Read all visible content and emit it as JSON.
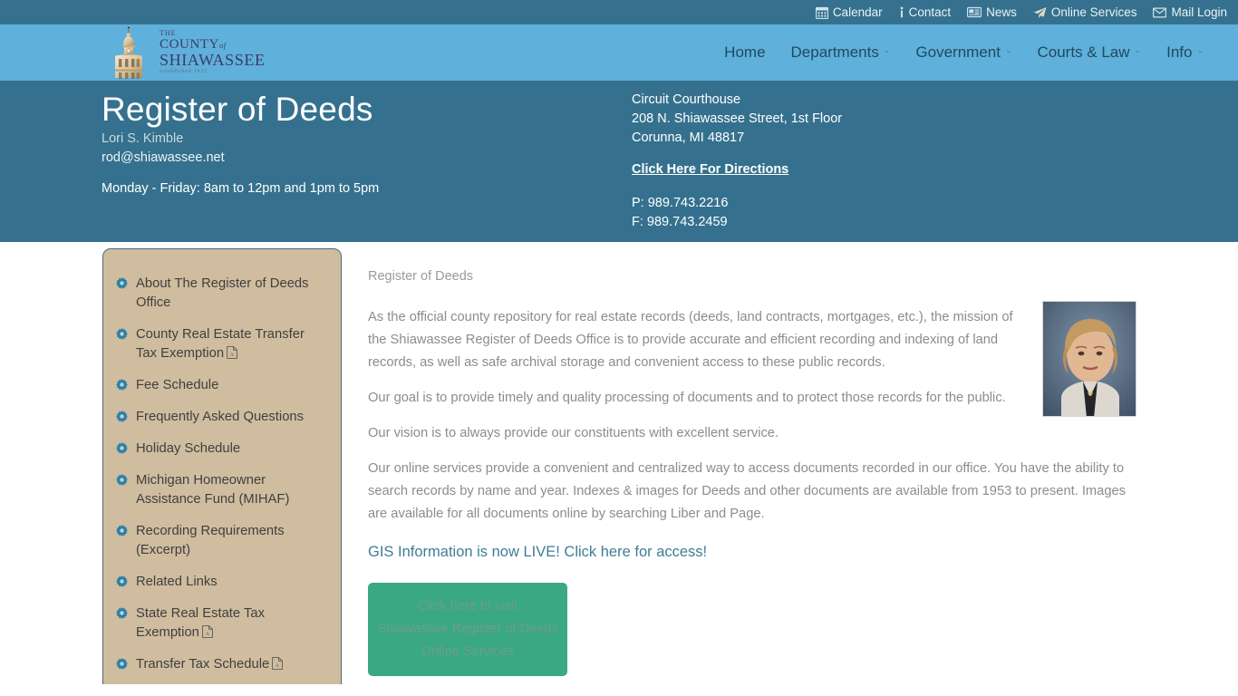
{
  "topbar": {
    "links": [
      {
        "label": "Calendar",
        "icon": "calendar-icon"
      },
      {
        "label": "Contact",
        "icon": "info-icon"
      },
      {
        "label": "News",
        "icon": "newspaper-icon"
      },
      {
        "label": "Online Services",
        "icon": "paper-plane-icon"
      },
      {
        "label": "Mail Login",
        "icon": "envelope-icon"
      }
    ],
    "bg_color": "#35718e"
  },
  "nav": {
    "bg_color": "#5fb0db",
    "logo": {
      "line_the": "THE",
      "line_county": "COUNTY",
      "line_of": "of",
      "line_shiawassee": "SHIAWASSEE",
      "tagline": "established 1822",
      "icon": "courthouse-dome-icon"
    },
    "items": [
      {
        "label": "Home",
        "has_dropdown": false
      },
      {
        "label": "Departments",
        "has_dropdown": true
      },
      {
        "label": "Government",
        "has_dropdown": true
      },
      {
        "label": "Courts & Law",
        "has_dropdown": true
      },
      {
        "label": "Info",
        "has_dropdown": true
      }
    ],
    "caret": "⌄"
  },
  "page_header": {
    "bg_color": "#35718e",
    "title": "Register of Deeds",
    "official_name": "Lori S. Kimble",
    "email": "rod@shiawassee.net",
    "hours": "Monday - Friday: 8am to 12pm and 1pm to 5pm",
    "address": [
      "Circuit Courthouse",
      "208 N. Shiawassee Street, 1st Floor",
      "Corunna, MI 48817"
    ],
    "directions_label": "Click Here For Directions",
    "phone": "P: 989.743.2216",
    "fax": "F: 989.743.2459"
  },
  "sidebar": {
    "bg_color": "#d0bd9f",
    "items": [
      {
        "label": "About The Register of Deeds Office",
        "pdf": false
      },
      {
        "label": "County Real Estate Transfer Tax Exemption",
        "pdf": true
      },
      {
        "label": "Fee Schedule",
        "pdf": false
      },
      {
        "label": "Frequently Asked Questions",
        "pdf": false
      },
      {
        "label": "Holiday Schedule",
        "pdf": false
      },
      {
        "label": "Michigan Homeowner Assistance Fund (MIHAF)",
        "pdf": false
      },
      {
        "label": "Recording Requirements (Excerpt)",
        "pdf": false
      },
      {
        "label": "Related Links",
        "pdf": false
      },
      {
        "label": "State Real Estate Tax Exemption",
        "pdf": true
      },
      {
        "label": "Transfer Tax Schedule",
        "pdf": true
      }
    ]
  },
  "main": {
    "breadcrumb": "Register of Deeds",
    "portrait_alt": "portrait-of-register-of-deeds",
    "paragraphs": [
      "As the official county repository for real estate records (deeds, land contracts, mortgages, etc.), the mission of the Shiawassee Register of Deeds Office is to provide accurate and efficient recording and indexing of land records, as well as safe archival storage and convenient access to these public records.",
      "Our goal is to provide timely and quality processing of documents and to protect those records for the public.",
      "Our vision is to always provide our constituents with excellent service.",
      "Our online services provide a convenient and centralized way to access documents recorded in our office. You have the ability to search records by name and year. Indexes & images for Deeds and other documents are available from 1953 to present. Images are available for all documents online by searching Liber and Page."
    ],
    "gis_link": "GIS Information is now LIVE! Click here for access!",
    "cta_button": {
      "line1": "Click here to visit",
      "line2": "Shiawassee Register of Deeds",
      "line3": "Online Services",
      "bg_color": "#3aa883"
    }
  }
}
